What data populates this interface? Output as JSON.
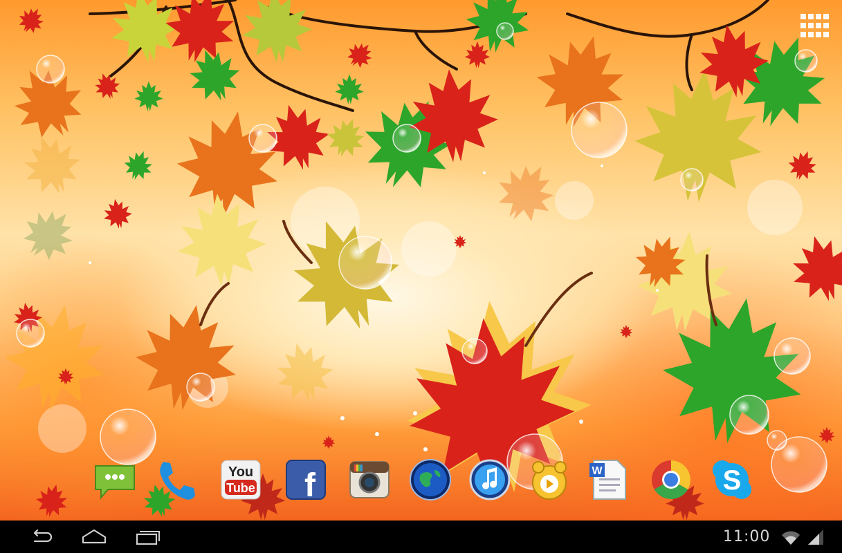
{
  "status_bar": {
    "time": "11:00"
  },
  "icons": {
    "all_apps": "all-apps-grid-icon",
    "back": "back-icon",
    "home": "home-icon",
    "recents": "recent-apps-icon",
    "wifi": "wifi-icon",
    "signal": "signal-icon"
  },
  "dock": {
    "apps": [
      {
        "name": "Messaging",
        "icon": "messaging-icon"
      },
      {
        "name": "Phone",
        "icon": "phone-icon"
      },
      {
        "name": "YouTube",
        "icon": "youtube-icon",
        "text_top": "You",
        "text_bottom": "Tube"
      },
      {
        "name": "Facebook",
        "icon": "facebook-icon",
        "text": "f"
      },
      {
        "name": "Instagram",
        "icon": "instagram-icon"
      },
      {
        "name": "Browser",
        "icon": "globe-icon"
      },
      {
        "name": "Music",
        "icon": "music-icon"
      },
      {
        "name": "GOM Player",
        "icon": "gom-player-icon"
      },
      {
        "name": "Word",
        "icon": "word-document-icon",
        "text": "W"
      },
      {
        "name": "Chrome",
        "icon": "chrome-icon"
      },
      {
        "name": "Skype",
        "icon": "skype-icon",
        "text": "S"
      }
    ]
  },
  "colors": {
    "leaf_red": "#d8221a",
    "leaf_orange": "#e8731c",
    "leaf_yellow": "#e9c83a",
    "leaf_green": "#2da52b",
    "navbar": "#000000",
    "clock_text": "#d8d8d8"
  }
}
